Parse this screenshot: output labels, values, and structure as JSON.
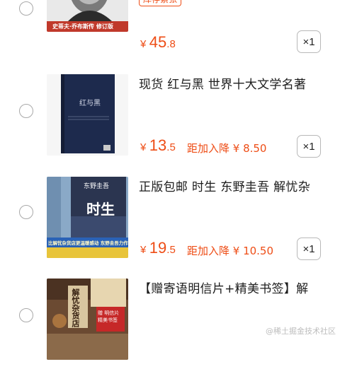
{
  "colors": {
    "price": "#ee4d16",
    "border": "#b8b8b8",
    "radio": "#a9a9a9"
  },
  "items": [
    {
      "stock_tag": "库存紧张",
      "title": "",
      "price_symbol": "¥",
      "price_int": "45",
      "price_dec": ".8",
      "drop_text": "",
      "qty": "×1",
      "cover_caption": "史蒂夫·乔布斯传 修订版"
    },
    {
      "title": "现货 红与黑 世界十大文学名著",
      "price_symbol": "¥",
      "price_int": "13",
      "price_dec": ".5",
      "drop_text": "距加入降 ¥ 8.50",
      "qty": "×1",
      "cover_title": "红与黑"
    },
    {
      "title": "正版包邮 时生 东野圭吾 解忧杂",
      "price_symbol": "¥",
      "price_int": "19",
      "price_dec": ".5",
      "drop_text": "距加入降 ¥ 10.50",
      "qty": "×1",
      "cover_title": "时生",
      "cover_author": "东野圭吾",
      "cover_banner": "比解忧杂货店更温暖感动 东野圭吾力作"
    },
    {
      "title": "【赠寄语明信片+精美书签】解",
      "cover_title": "解忧杂货店",
      "cover_badge": "赠 明信片 精美书签"
    }
  ],
  "watermark": "@稀土掘金技术社区"
}
